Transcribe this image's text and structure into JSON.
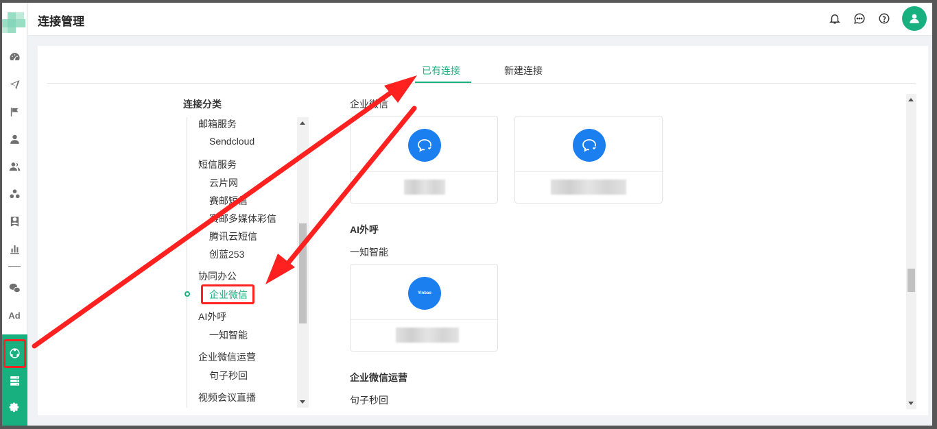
{
  "header": {
    "title": "连接管理"
  },
  "tabs": [
    {
      "label": "已有连接",
      "active": true
    },
    {
      "label": "新建连接",
      "active": false
    }
  ],
  "category": {
    "title": "连接分类",
    "items": [
      {
        "label": "邮箱服务",
        "level": "group"
      },
      {
        "label": "Sendcloud",
        "level": "sub"
      },
      {
        "label": "短信服务",
        "level": "group"
      },
      {
        "label": "云片网",
        "level": "sub"
      },
      {
        "label": "赛邮短信",
        "level": "sub"
      },
      {
        "label": "赛邮多媒体彩信",
        "level": "sub"
      },
      {
        "label": "腾讯云短信",
        "level": "sub"
      },
      {
        "label": "创蓝253",
        "level": "sub"
      },
      {
        "label": "协同办公",
        "level": "group"
      },
      {
        "label": "企业微信",
        "level": "sub",
        "selected": true
      },
      {
        "label": "AI外呼",
        "level": "group"
      },
      {
        "label": "一知智能",
        "level": "sub"
      },
      {
        "label": "企业微信运营",
        "level": "group"
      },
      {
        "label": "句子秒回",
        "level": "sub"
      },
      {
        "label": "视频会议直播",
        "level": "group"
      }
    ]
  },
  "content": {
    "section_wecom": "企业微信",
    "section_ai": "AI外呼",
    "ai_sub": "一知智能",
    "section_wecom_ops": "企业微信运营",
    "wecom_ops_sub": "句子秒回",
    "yinbao_logo": "Yinbao"
  },
  "colors": {
    "accent": "#19b07f",
    "card_icon": "#1b7ff0",
    "annotation": "#ff2020"
  },
  "icons": {
    "sidebar": [
      "dashboard-icon",
      "send-icon",
      "flag-icon",
      "user-icon",
      "users-icon",
      "cluster-icon",
      "badge-icon",
      "bar-chart-icon",
      "wechat-icon",
      "ad-icon",
      "connection-icon",
      "server-icon",
      "settings-icon"
    ],
    "header": [
      "bell-icon",
      "message-icon",
      "help-icon",
      "avatar-icon"
    ]
  }
}
